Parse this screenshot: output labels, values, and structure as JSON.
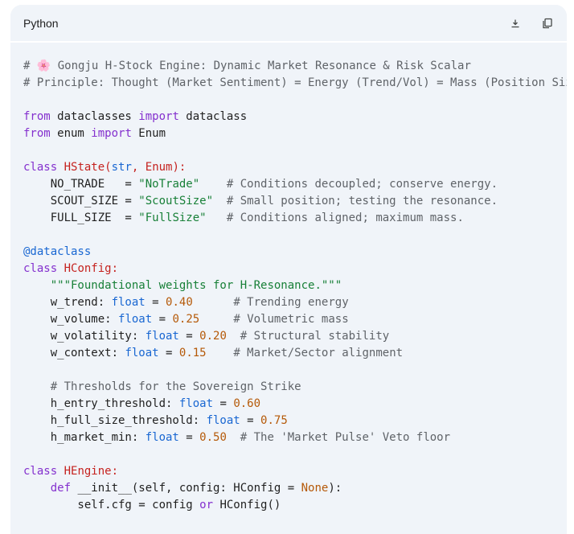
{
  "header": {
    "language": "Python"
  },
  "icons": {
    "download": "download-icon",
    "copy": "copy-icon"
  },
  "code": {
    "l1a": "# ",
    "l1b": "🌸",
    "l1c": " Gongju H-Stock Engine: Dynamic Market Resonance & Risk Scalar",
    "l2": "# Principle: Thought (Market Sentiment) = Energy (Trend/Vol) = Mass (Position Siz",
    "from": "from",
    "import": "import",
    "dataclasses": " dataclasses ",
    "dataclass": " dataclass",
    "enum": " enum ",
    "Enum": " Enum",
    "class": "class",
    "HState": "HState",
    "str": "str",
    "EnumBase": "Enum",
    "no_trade_name": "    NO_TRADE   = ",
    "no_trade_val": "\"NoTrade\"",
    "no_trade_com": "# Conditions decoupled; conserve energy.",
    "scout_name": "    SCOUT_SIZE = ",
    "scout_val": "\"ScoutSize\"",
    "scout_com": "# Small position; testing the resonance.",
    "full_name": "    FULL_SIZE  = ",
    "full_val": "\"FullSize\"",
    "full_com": "# Conditions aligned; maximum mass.",
    "decorator": "@dataclass",
    "HConfig": "HConfig",
    "docstring": "\"\"\"Foundational weights for H-Resonance.\"\"\"",
    "float": "float",
    "w_trend": "    w_trend: ",
    "w_trend_val": "0.40",
    "w_trend_com": "# Trending energy",
    "w_volume": "    w_volume: ",
    "w_volume_val": "0.25",
    "w_volume_com": "# Volumetric mass",
    "w_volatility": "    w_volatility: ",
    "w_volatility_val": "0.20",
    "w_volatility_com": "# Structural stability",
    "w_context": "    w_context: ",
    "w_context_val": "0.15",
    "w_context_com": "# Market/Sector alignment",
    "thresholds_com": "    # Thresholds for the Sovereign Strike",
    "h_entry": "    h_entry_threshold: ",
    "h_entry_val": "0.60",
    "h_full": "    h_full_size_threshold: ",
    "h_full_val": "0.75",
    "h_market": "    h_market_min: ",
    "h_market_val": "0.50",
    "h_market_com": "# The 'Market Pulse' Veto floor",
    "HEngine": "HEngine",
    "def": "def",
    "init_sig": " __init__(self, config: HConfig = ",
    "None": "None",
    "init_end": "):",
    "self_cfg": "        self.cfg = config ",
    "or": "or",
    "hconfig_call": " HConfig()"
  }
}
